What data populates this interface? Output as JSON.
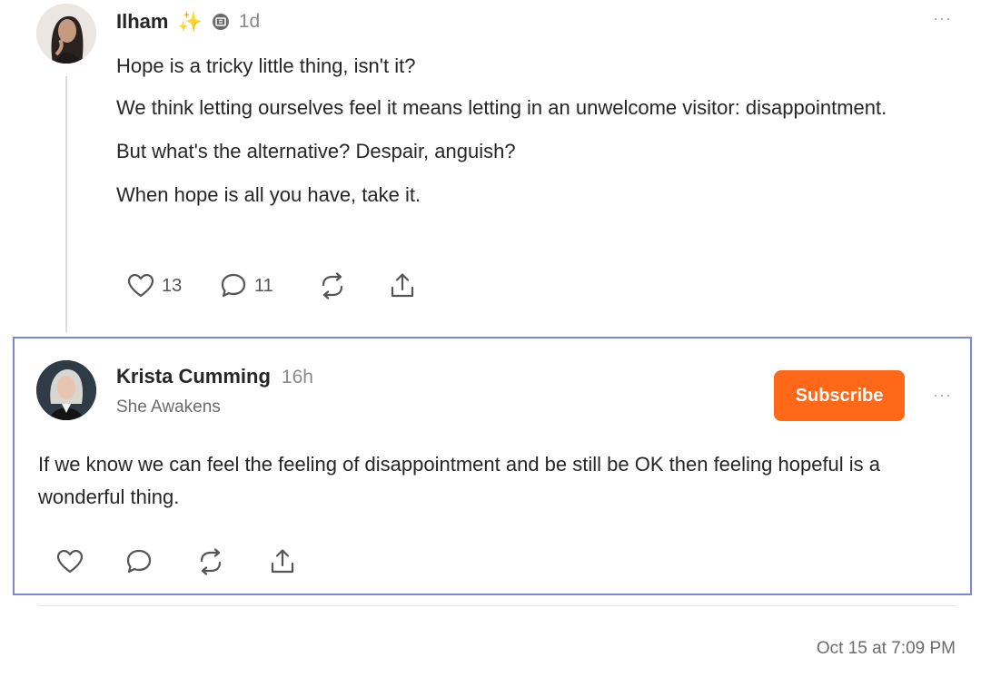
{
  "post1": {
    "author": "Ilham",
    "sparkle": "✨",
    "time": "1d",
    "paragraphs": [
      "Hope is a tricky little thing, isn't it?",
      "We think letting ourselves feel it means letting in an unwelcome visitor: disappointment.",
      "But what's the alternative? Despair, anguish?",
      "When hope is all you have, take it."
    ],
    "likes": "13",
    "comments": "11",
    "more": "···"
  },
  "post2": {
    "author": "Krista Cumming",
    "time": "16h",
    "publication": "She Awakens",
    "subscribe_label": "Subscribe",
    "text": "If we know we can feel the feeling of disappointment and be still be OK then feeling hopeful is a wonderful thing.",
    "more": "···"
  },
  "footer": {
    "date": "Oct 15 at 7:09 PM"
  },
  "colors": {
    "accent": "#ff6719",
    "highlight_border": "#7b86d6"
  }
}
